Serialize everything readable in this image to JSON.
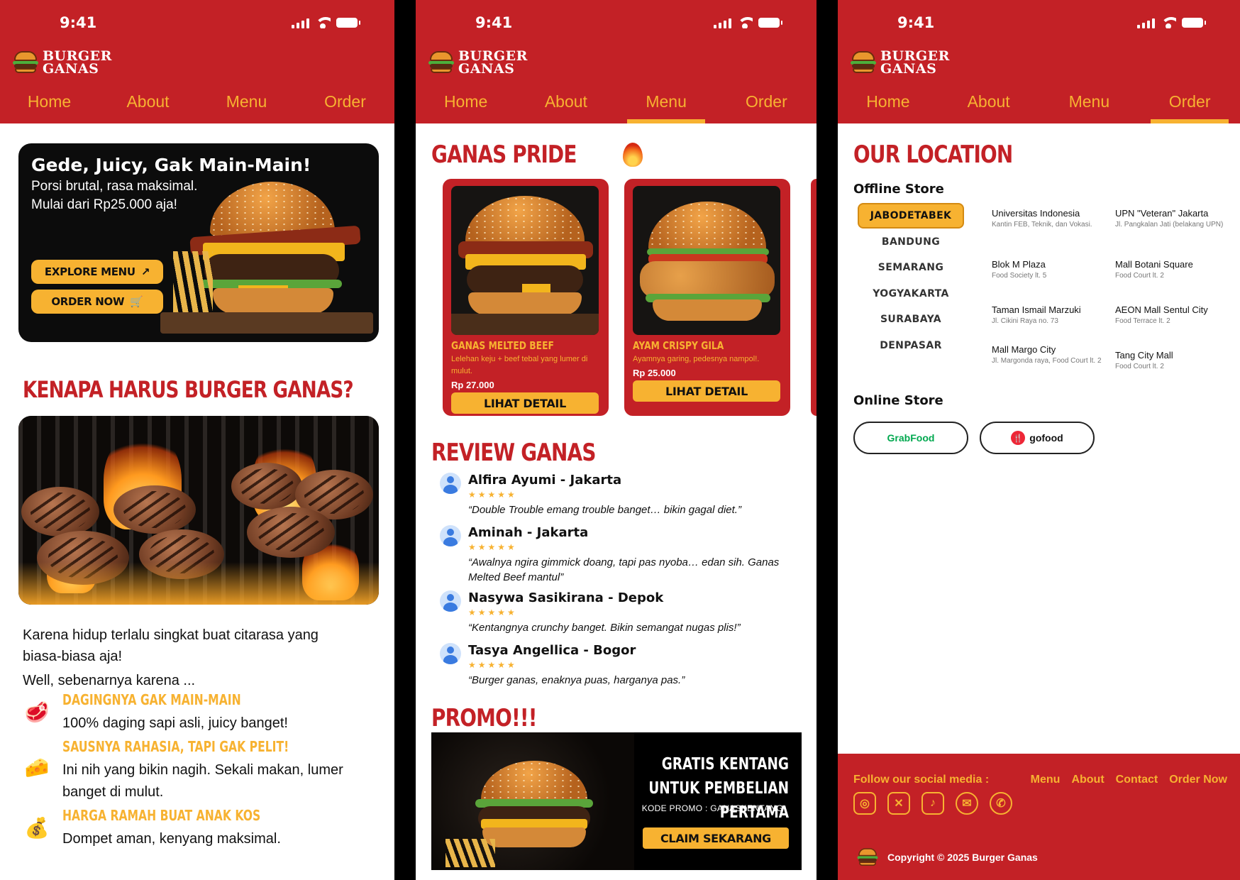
{
  "status": {
    "time": "9:41"
  },
  "brand": {
    "line1": "BURGER",
    "line2": "GANAS"
  },
  "nav": [
    "Home",
    "About",
    "Menu",
    "Order"
  ],
  "colors": {
    "primary": "#c32126",
    "accent": "#f7b231"
  },
  "home": {
    "hero": {
      "title": "Gede, Juicy, Gak Main-Main!",
      "line1": "Porsi brutal, rasa maksimal.",
      "line2": "Mulai dari Rp25.000 aja!",
      "explore_label": "EXPLORE MENU",
      "order_label": "ORDER NOW"
    },
    "why_title": "KENAPA HARUS BURGER GANAS?",
    "intro1": "Karena hidup terlalu singkat buat citarasa yang",
    "intro2": "biasa-biasa aja!",
    "intro3": "Well, sebenarnya karena ...",
    "reasons": [
      {
        "title": "DAGINGNYA GAK MAIN-MAIN",
        "desc": "100% daging sapi asli, juicy banget!",
        "icon": "steak-icon"
      },
      {
        "title": "SAUSNYA RAHASIA, TAPI GAK PELIT!",
        "desc": "Ini nih yang bikin nagih. Sekali makan, lumer banget di mulut.",
        "icon": "cheese-icon"
      },
      {
        "title": "HARGA RAMAH BUAT ANAK KOS",
        "desc": "Dompet aman, kenyang maksimal.",
        "icon": "money-bag-icon"
      }
    ]
  },
  "menu": {
    "pride_title": "GANAS PRIDE",
    "products": [
      {
        "name": "GANAS MELTED BEEF",
        "desc": "Lelehan keju + beef tebal yang lumer di mulut.",
        "price": "Rp 27.000",
        "button": "LIHAT DETAIL"
      },
      {
        "name": "AYAM CRISPY GILA",
        "desc": "Ayamnya garing, pedesnya nampol!.",
        "price": "Rp 25.000",
        "button": "LIHAT DETAIL"
      }
    ],
    "review_title": "REVIEW GANAS",
    "reviews": [
      {
        "name": "Alfira Ayumi - Jakarta",
        "stars": "★★★★★",
        "quote": "“Double Trouble emang trouble banget… bikin gagal diet.”"
      },
      {
        "name": "Aminah - Jakarta",
        "stars": "★★★★★",
        "quote": "“Awalnya ngira gimmick doang, tapi pas nyoba… edan sih. Ganas Melted Beef mantul”"
      },
      {
        "name": "Nasywa Sasikirana - Depok",
        "stars": "★★★★★",
        "quote": "“Kentangnya crunchy banget. Bikin semangat nugas plis!”"
      },
      {
        "name": "Tasya Angellica - Bogor",
        "stars": "★★★★★",
        "quote": "“Burger ganas, enaknya puas, harganya pas.”"
      }
    ],
    "promo_title": "PROMO!!!",
    "promo": {
      "headline": "GRATIS KENTANG UNTUK PEMBELIAN PERTAMA",
      "code": "KODE PROMO : GANASKENTANG",
      "button": "CLAIM SEKARANG"
    }
  },
  "order": {
    "location_title": "OUR LOCATION",
    "offline_title": "Offline Store",
    "regions": [
      "JABODETABEK",
      "BANDUNG",
      "SEMARANG",
      "YOGYAKARTA",
      "SURABAYA",
      "DENPASAR"
    ],
    "active_region": "JABODETABEK",
    "stores": [
      {
        "name": "Universitas Indonesia",
        "addr": "Kantin FEB, Teknik, dan Vokasi."
      },
      {
        "name": "UPN \"Veteran\" Jakarta",
        "addr": "Jl. Pangkalan Jati (belakang UPN)"
      },
      {
        "name": "Blok M Plaza",
        "addr": "Food Society lt. 5"
      },
      {
        "name": "Mall Botani Square",
        "addr": "Food Court lt. 2"
      },
      {
        "name": "Taman Ismail Marzuki",
        "addr": "Jl. Cikini Raya no. 73"
      },
      {
        "name": "AEON Mall Sentul City",
        "addr": "Food Terrace lt. 2"
      },
      {
        "name": "Mall Margo City",
        "addr": "Jl. Margonda raya, Food Court lt. 2"
      },
      {
        "name": "Tang City Mall",
        "addr": "Food Court lt. 2"
      }
    ],
    "online_title": "Online Store",
    "online": [
      "GrabFood",
      "gofood"
    ],
    "footer": {
      "follow": "Follow our social media :",
      "links": [
        "Menu",
        "About",
        "Contact",
        "Order Now"
      ],
      "socials": [
        "instagram-icon",
        "x-icon",
        "tiktok-icon",
        "email-icon",
        "whatsapp-icon"
      ],
      "copyright": "Copyright © 2025 Burger Ganas"
    }
  }
}
